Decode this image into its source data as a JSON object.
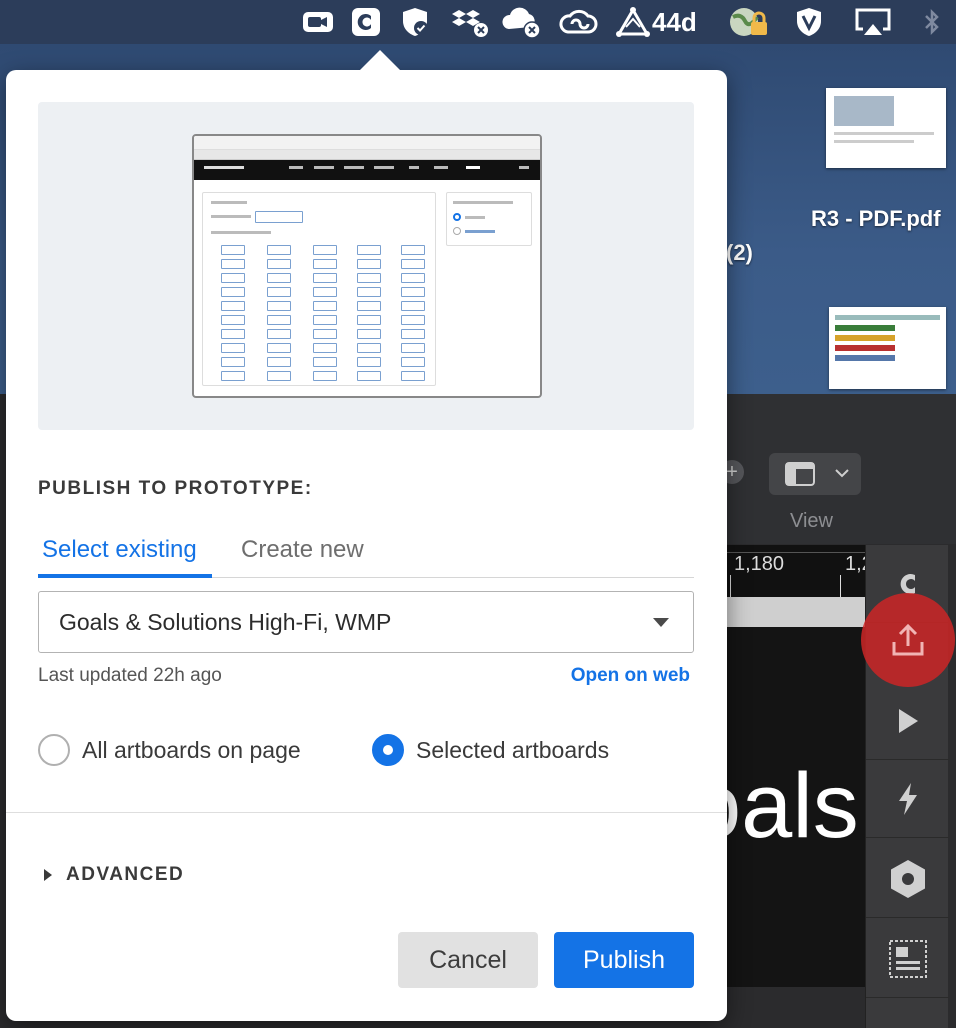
{
  "menubar": {
    "icons": [
      "video-icon",
      "creative-cloud-c-icon",
      "shield-check-icon",
      "dropbox-error-icon",
      "cloud-error-icon",
      "creative-cloud-icon",
      "app-triangle-icon",
      "vpn-lock-icon",
      "shield-v-icon",
      "airplay-icon",
      "bluetooth-icon"
    ],
    "badge_text": "44d"
  },
  "desktop": {
    "file_label_1": "R3 - PDF.pdf",
    "file_label_2": "(2)"
  },
  "app": {
    "view_label": "View",
    "ruler_label_1": "1,180",
    "ruler_label_2": "1,2",
    "canvas_text": "oals"
  },
  "popover": {
    "section_title": "PUBLISH TO PROTOTYPE:",
    "tabs": [
      {
        "label": "Select existing",
        "active": true
      },
      {
        "label": "Create new",
        "active": false
      }
    ],
    "prototype_select": {
      "value": "Goals & Solutions High-Fi, WMP"
    },
    "last_updated": "Last updated 22h ago",
    "open_on_web": "Open on web",
    "scope_options": [
      {
        "label": "All artboards on page",
        "selected": false
      },
      {
        "label": "Selected artboards",
        "selected": true
      }
    ],
    "advanced_label": "ADVANCED",
    "cancel_label": "Cancel",
    "publish_label": "Publish"
  },
  "colors": {
    "accent": "#1473e6",
    "highlight_red": "#cd2626"
  }
}
